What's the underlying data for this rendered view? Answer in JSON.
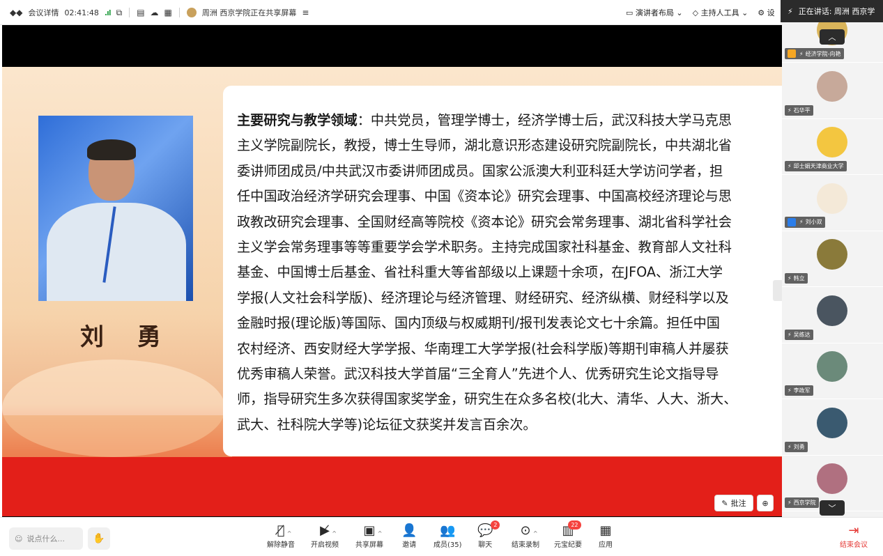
{
  "topbar": {
    "meeting_info": "会议详情",
    "timer": "02:41:48",
    "sharer": "周洲 西京学院正在共享屏幕",
    "speaker_layout": "演讲者布局",
    "host_tools": "主持人工具",
    "settings": "设",
    "speaking_label": "正在讲话: 周洲 西京学"
  },
  "slide": {
    "name": "刘  勇",
    "lead": "主要研究与教学领域",
    "body": "：中共党员，管理学博士，经济学博士后，武汉科技大学马克思\n主义学院副院长，教授，博士生导师，湖北意识形态建设研究院副院长，中共湖北省\n委讲师团成员/中共武汉市委讲师团成员。国家公派澳大利亚科廷大学访问学者，担\n任中国政治经济学研究会理事、中国《资本论》研究会理事、中国高校经济理论与思\n政教改研究会理事、全国财经高等院校《资本论》研究会常务理事、湖北省科学社会\n主义学会常务理事等等重要学会学术职务。主持完成国家社科基金、教育部人文社科\n基金、中国博士后基金、省社科重大等省部级以上课题十余项，在JFOA、浙江大学\n学报(人文社会科学版)、经济理论与经济管理、财经研究、经济纵横、财经科学以及\n金融时报(理论版)等国际、国内顶级与权威期刊/报刊发表论文七十余篇。担任中国\n农村经济、西安财经大学学报、华南理工大学学报(社会科学版)等期刊审稿人并屡获\n优秀审稿人荣誉。武汉科技大学首届“三全育人”先进个人、优秀研究生论文指导导\n师，指导研究生多次获得国家奖学金，研究生在众多名校(北大、清华、人大、浙大、\n武大、社科院大学等)论坛征文获奖并发言百余次。"
  },
  "stage_controls": {
    "annotate": "批注"
  },
  "participants": [
    {
      "name": "经济学院-向艳",
      "role": "host",
      "color": "#d9b45a"
    },
    {
      "name": "石华平",
      "role": "none",
      "color": "#c7a99a"
    },
    {
      "name": "邱士娟天津商业大学",
      "role": "none",
      "color": "#f3c640"
    },
    {
      "name": "刘小双",
      "role": "cohost",
      "color": "#f4e9d8"
    },
    {
      "name": "韩立",
      "role": "none",
      "color": "#8a7a3a"
    },
    {
      "name": "吴练达",
      "role": "none",
      "color": "#4a5560"
    },
    {
      "name": "李政军",
      "role": "none",
      "color": "#6b8a7a"
    },
    {
      "name": "刘勇",
      "role": "none",
      "color": "#3a5a70"
    },
    {
      "name": "西京学院",
      "role": "none",
      "color": "#b07080"
    }
  ],
  "bottombar": {
    "chat_placeholder": "说点什么...",
    "controls": {
      "unmute": "解除静音",
      "video": "开启视频",
      "share": "共享屏幕",
      "invite": "邀请",
      "members": "成员(35)",
      "chat": "聊天",
      "chat_badge": "2",
      "record": "结束录制",
      "yuanbao": "元宝纪要",
      "yuanbao_badge": "22",
      "apps": "应用"
    },
    "leave": "结束会议"
  }
}
